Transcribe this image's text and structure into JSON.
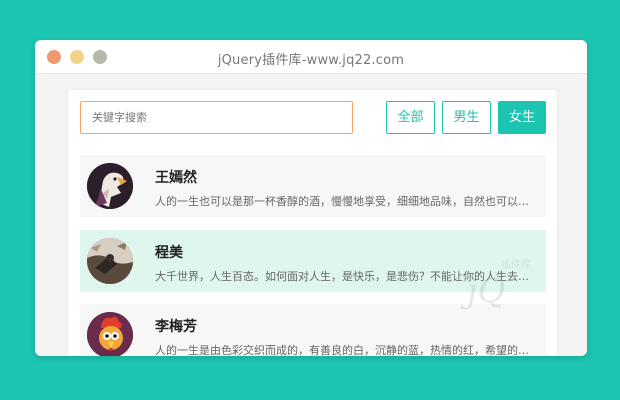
{
  "window": {
    "title": "jQuery插件库-www.jq22.com"
  },
  "search": {
    "placeholder": "关键字搜索"
  },
  "filters": [
    {
      "label": "全部",
      "active": false
    },
    {
      "label": "男生",
      "active": false
    },
    {
      "label": "女生",
      "active": true
    }
  ],
  "list": [
    {
      "name": "王嫣然",
      "desc": "人的一生也可以是那一杯香醇的酒，慢慢地享受，细细地品味，自然也可以韵味无穷"
    },
    {
      "name": "程美",
      "desc": "大千世界，人生百态。如何面对人生，是快乐，是悲伤？不能让你的人生去决定你的态度"
    },
    {
      "name": "李梅芳",
      "desc": "人的一生是由色彩交织而成的，有善良的白，沉静的蓝，热情的红，希望的绿，纯洁的紫"
    }
  ],
  "colors": {
    "accent": "#1cc4b2",
    "search_border": "#f0a860",
    "highlight_row": "#dff6ee"
  },
  "watermark": {
    "text": "插件库",
    "brand": "jQuery"
  }
}
